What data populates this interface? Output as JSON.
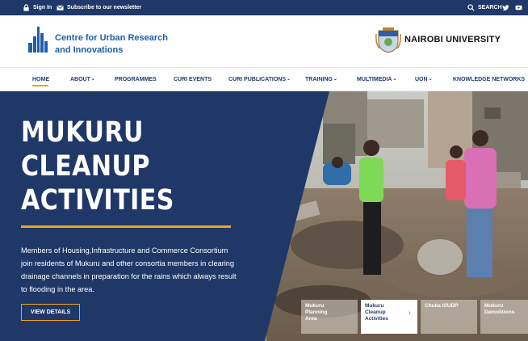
{
  "topbar": {
    "sign_in": "Sign In",
    "newsletter": "Subscribe to our newsletter",
    "search": "SEARCH"
  },
  "header": {
    "logo_line1": "Centre for Urban Research",
    "logo_line2": "and Innovations",
    "university": "NAIROBI UNIVERSITY"
  },
  "nav": {
    "items": [
      {
        "label": "HOME"
      },
      {
        "label": "ABOUT"
      },
      {
        "label": "PROGRAMMES"
      },
      {
        "label": "CURI EVENTS"
      },
      {
        "label": "CURI PUBLICATIONS"
      },
      {
        "label": "TRAINING"
      },
      {
        "label": "MULTIMEDIA"
      },
      {
        "label": "UON"
      },
      {
        "label": "KNOWLEDGE NETWORKS"
      }
    ]
  },
  "hero": {
    "title_line1": "MUKURU",
    "title_line2": "CLEANUP",
    "title_line3": "ACTIVITIES",
    "description": "Members of Housing,Infrastructure and Commerce Consortium join residents of Mukuru and other consortia members in clearing drainage channels in preparation for the rains which always result to flooding in the area.",
    "button": "VIEW DETAILS"
  },
  "slides": [
    {
      "line1": "Mukuru",
      "line2": "Planning",
      "line3": "Area"
    },
    {
      "line1": "Mukuru",
      "line2": "Cleanup",
      "line3": "Activities"
    },
    {
      "line1": "Chuka ISUDP",
      "line2": "",
      "line3": ""
    },
    {
      "line1": "Mukuru",
      "line2": "Demolitions",
      "line3": ""
    }
  ],
  "colors": {
    "navy": "#1f3868",
    "accent": "#f0a31b",
    "link_blue": "#1f5ea8"
  }
}
